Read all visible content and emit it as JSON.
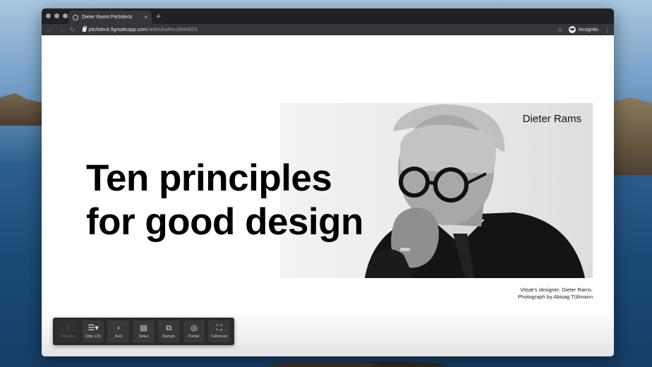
{
  "browser": {
    "tab_title": "Dieter Rams Pitchdeck",
    "tab_close": "×",
    "new_tab": "+",
    "url_host": "pitchdeck.figmaticapp.com",
    "url_path": "/slides/ka94cu0b64023",
    "incognito_label": "Incognito",
    "back_icon": "←",
    "forward_icon": "→",
    "reload_icon": "↻",
    "star_icon": "☆",
    "menu_icon": "⋮"
  },
  "slide": {
    "headline_line1": "Ten principles",
    "headline_line2": "for good design",
    "photo_label": "Dieter Rams",
    "caption_line1": "Vitsœ's designer, Dieter Rams.",
    "caption_line2": "Photograph by Abisag Tüllmann"
  },
  "controls": [
    {
      "label": "Previous",
      "icon": "‹",
      "enabled": false,
      "name": "previous-button",
      "icon_name": "chevron-left-icon"
    },
    {
      "label": "Slide 1/11",
      "icon": "☰▾",
      "enabled": true,
      "name": "slide-selector-button",
      "icon_name": "list-icon"
    },
    {
      "label": "Next",
      "icon": "›",
      "enabled": true,
      "name": "next-button",
      "icon_name": "chevron-right-icon"
    },
    {
      "label": "Notes",
      "icon": "▤",
      "enabled": true,
      "name": "notes-button",
      "icon_name": "notes-icon"
    },
    {
      "label": "Remote",
      "icon": "⧉",
      "enabled": true,
      "name": "remote-button",
      "icon_name": "remote-devices-icon"
    },
    {
      "label": "Pointer",
      "icon": "◎",
      "enabled": true,
      "name": "pointer-button",
      "icon_name": "pointer-icon"
    },
    {
      "label": "Fullscreen",
      "icon": "⛶",
      "enabled": true,
      "name": "fullscreen-button",
      "icon_name": "fullscreen-icon"
    }
  ],
  "colors": {
    "browser_chrome": "#202124",
    "toolbar": "#35363a",
    "controls_bg": "#2b2b2b"
  }
}
